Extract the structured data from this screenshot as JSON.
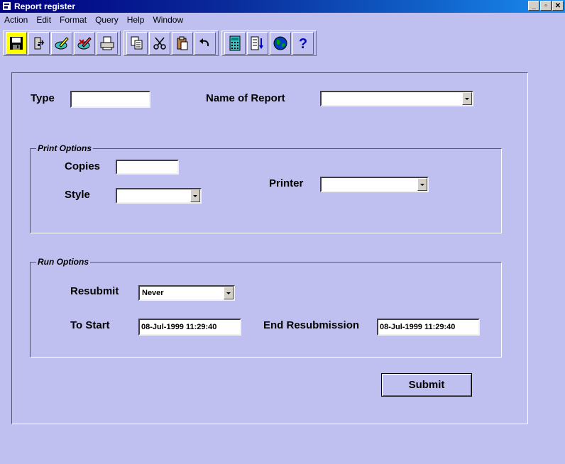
{
  "window": {
    "title": "Report register"
  },
  "menu": {
    "items": [
      "Action",
      "Edit",
      "Format",
      "Query",
      "Help",
      "Window"
    ]
  },
  "toolbar": {
    "groups": [
      [
        "save-icon",
        "exit-icon",
        "edit-record-icon",
        "delete-record-icon",
        "print-icon"
      ],
      [
        "copy-icon",
        "cut-icon",
        "paste-icon",
        "undo-icon"
      ],
      [
        "calculator-icon",
        "list-sort-icon",
        "globe-icon",
        "help-icon"
      ]
    ]
  },
  "form": {
    "type_label": "Type",
    "type_value": "",
    "report_name_label": "Name of Report",
    "report_name_value": "",
    "print_options": {
      "legend": "Print Options",
      "copies_label": "Copies",
      "copies_value": "",
      "style_label": "Style",
      "style_value": "",
      "printer_label": "Printer",
      "printer_value": ""
    },
    "run_options": {
      "legend": "Run Options",
      "resubmit_label": "Resubmit",
      "resubmit_value": "Never",
      "to_start_label": "To Start",
      "to_start_value": "08-Jul-1999 11:29:40",
      "end_resubmission_label": "End Resubmission",
      "end_resubmission_value": "08-Jul-1999 11:29:40"
    },
    "submit_label": "Submit"
  }
}
